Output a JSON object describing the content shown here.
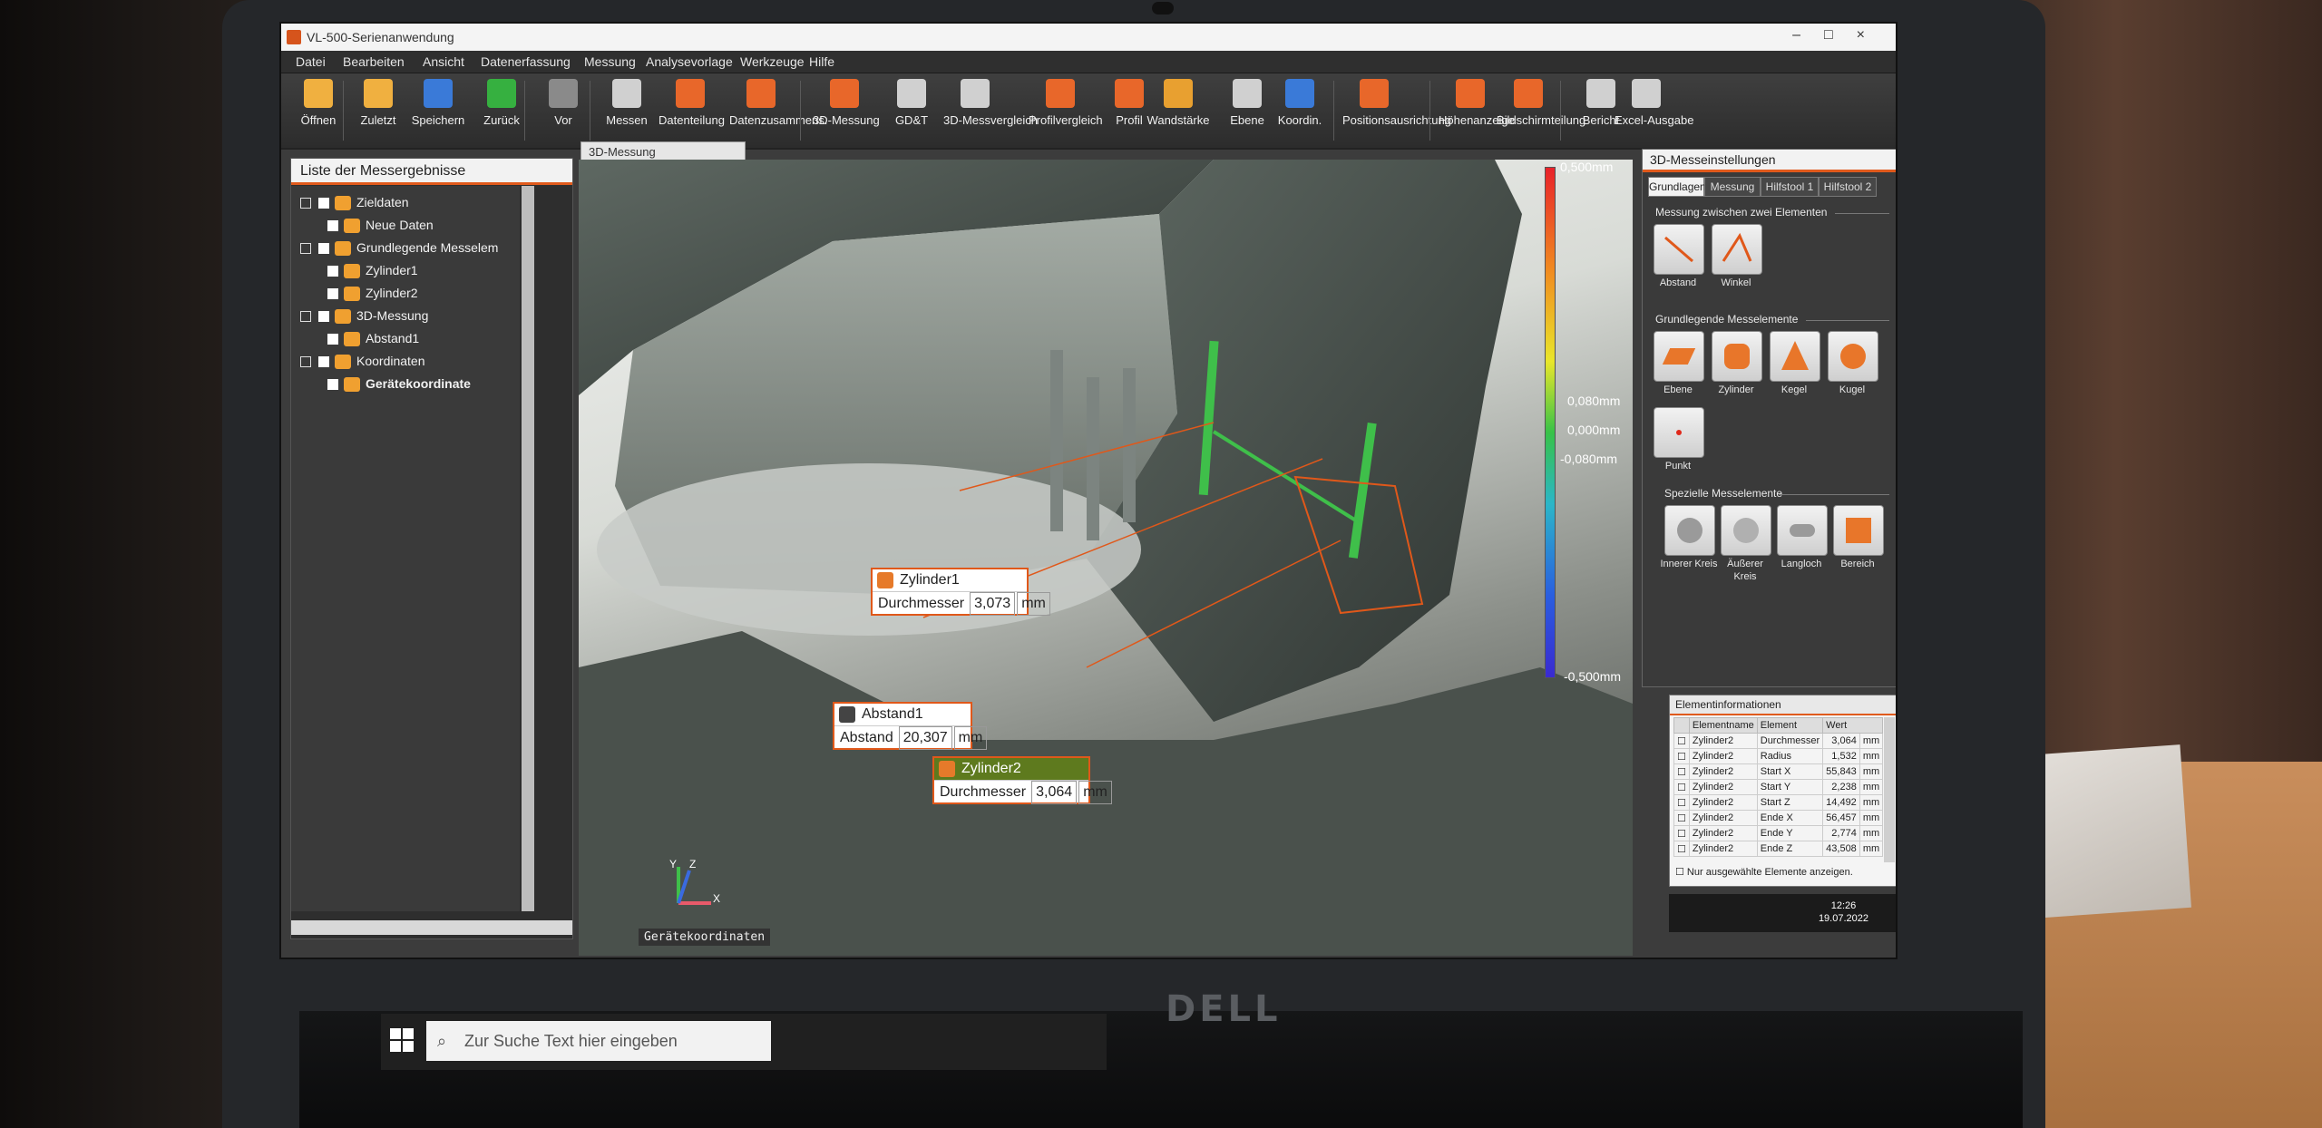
{
  "window": {
    "title": "VL-500-Serienanwendung",
    "buttons": [
      "–",
      "□",
      "×"
    ]
  },
  "menu": [
    "Datei",
    "Bearbeiten",
    "Ansicht",
    "Datenerfassung",
    "Messung",
    "Analysevorlage",
    "Werkzeuge",
    "Hilfe"
  ],
  "toolbar": [
    {
      "label": "Öffnen",
      "icon": "folder-icon",
      "color": "#f0b040"
    },
    {
      "label": "Zuletzt",
      "icon": "recent-file-icon",
      "color": "#f0b040"
    },
    {
      "label": "Speichern",
      "icon": "save-icon",
      "color": "#3a7ad8"
    },
    {
      "label": "Zurück",
      "icon": "undo-icon",
      "color": "#36b040"
    },
    {
      "label": "Vor",
      "icon": "redo-icon",
      "color": "#8a8a8a"
    },
    {
      "label": "Messen",
      "icon": "measure-icon",
      "color": "#d0d0d0"
    },
    {
      "label": "Datenteilung",
      "icon": "split-data-icon",
      "color": "#e8672a"
    },
    {
      "label": "Datenzusammens.",
      "icon": "merge-data-icon",
      "color": "#e8672a"
    },
    {
      "label": "3D-Messung",
      "icon": "3d-measure-icon",
      "color": "#e8672a"
    },
    {
      "label": "GD&T",
      "icon": "gdt-icon",
      "color": "#d0d0d0"
    },
    {
      "label": "3D-Messvergleich",
      "icon": "3d-compare-icon",
      "color": "#d0d0d0"
    },
    {
      "label": "Profilvergleich",
      "icon": "profile-compare-icon",
      "color": "#e8672a"
    },
    {
      "label": "Profil",
      "icon": "profile-icon",
      "color": "#e8672a"
    },
    {
      "label": "Wandstärke",
      "icon": "wall-thickness-icon",
      "color": "#e8a030"
    },
    {
      "label": "Ebene",
      "icon": "plane-icon",
      "color": "#d0d0d0"
    },
    {
      "label": "Koordin.",
      "icon": "coordinates-icon",
      "color": "#3a7ad8"
    },
    {
      "label": "Positionsausrichtung",
      "icon": "alignment-icon",
      "color": "#e8672a"
    },
    {
      "label": "Höhenanzeige",
      "icon": "height-display-icon",
      "color": "#e8672a"
    },
    {
      "label": "Bildschirmteilung",
      "icon": "screen-split-icon",
      "color": "#e8672a"
    },
    {
      "label": "Bericht",
      "icon": "report-icon",
      "color": "#d0d0d0"
    },
    {
      "label": "Excel-Ausgabe",
      "icon": "excel-icon",
      "color": "#d0d0d0"
    }
  ],
  "left_panel": {
    "title": "Liste der Messergebnisse",
    "tree": [
      {
        "label": "Zieldaten",
        "level": 0
      },
      {
        "label": "Neue Daten",
        "level": 1
      },
      {
        "label": "Grundlegende Messelem",
        "level": 0
      },
      {
        "label": "Zylinder1",
        "level": 1
      },
      {
        "label": "Zylinder2",
        "level": 1
      },
      {
        "label": "3D-Messung",
        "level": 0
      },
      {
        "label": "Abstand1",
        "level": 1
      },
      {
        "label": "Koordinaten",
        "level": 0
      },
      {
        "label": "Gerätekoordinate",
        "level": 1
      }
    ]
  },
  "viewport": {
    "tab": "3D-Messung",
    "footer": "Gerätekoordinaten",
    "colorbar": {
      "max": "0,500mm",
      "upper": "0,080mm",
      "zero": "0,000mm",
      "lower": "-0,080mm",
      "min": "-0,500mm"
    },
    "axes": {
      "x": "X",
      "y": "Y",
      "z": "Z"
    },
    "callouts": [
      {
        "name": "Zylinder1",
        "field": "Durchmesser",
        "value": "3,073",
        "unit": "mm"
      },
      {
        "name": "Abstand1",
        "field": "Abstand",
        "value": "20,307",
        "unit": "mm"
      },
      {
        "name": "Zylinder2",
        "field": "Durchmesser",
        "value": "3,064",
        "unit": "mm"
      }
    ]
  },
  "right_panel": {
    "title": "3D-Messeinstellungen",
    "tabs": [
      "Grundlagen",
      "Messung",
      "Hilfstool 1",
      "Hilfstool 2"
    ],
    "groups": [
      {
        "title": "Messung zwischen zwei Elementen",
        "tools": [
          "Abstand",
          "Winkel"
        ]
      },
      {
        "title": "Grundlegende Messelemente",
        "tools": [
          "Ebene",
          "Zylinder",
          "Kegel",
          "Kugel",
          "Punkt"
        ]
      },
      {
        "title": "Spezielle Messelemente",
        "tools": [
          "Innerer Kreis",
          "Äußerer Kreis",
          "Langloch",
          "Bereich"
        ]
      }
    ]
  },
  "element_info": {
    "title": "Elementinformationen",
    "columns": [
      "Elementname",
      "Element",
      "Wert"
    ],
    "rows": [
      [
        "Zylinder2",
        "Durchmesser",
        "3,064",
        "mm"
      ],
      [
        "Zylinder2",
        "Radius",
        "1,532",
        "mm"
      ],
      [
        "Zylinder2",
        "Start X",
        "55,843",
        "mm"
      ],
      [
        "Zylinder2",
        "Start Y",
        "2,238",
        "mm"
      ],
      [
        "Zylinder2",
        "Start Z",
        "14,492",
        "mm"
      ],
      [
        "Zylinder2",
        "Ende X",
        "56,457",
        "mm"
      ],
      [
        "Zylinder2",
        "Ende Y",
        "2,774",
        "mm"
      ],
      [
        "Zylinder2",
        "Ende Z",
        "43,508",
        "mm"
      ]
    ],
    "footer": "Nur ausgewählte Elemente anzeigen."
  },
  "tray": {
    "time": "12:26",
    "date": "19.07.2022"
  },
  "taskbar": {
    "search_placeholder": "Zur Suche Text hier eingeben"
  },
  "brand": {
    "laptop": "DELL"
  }
}
